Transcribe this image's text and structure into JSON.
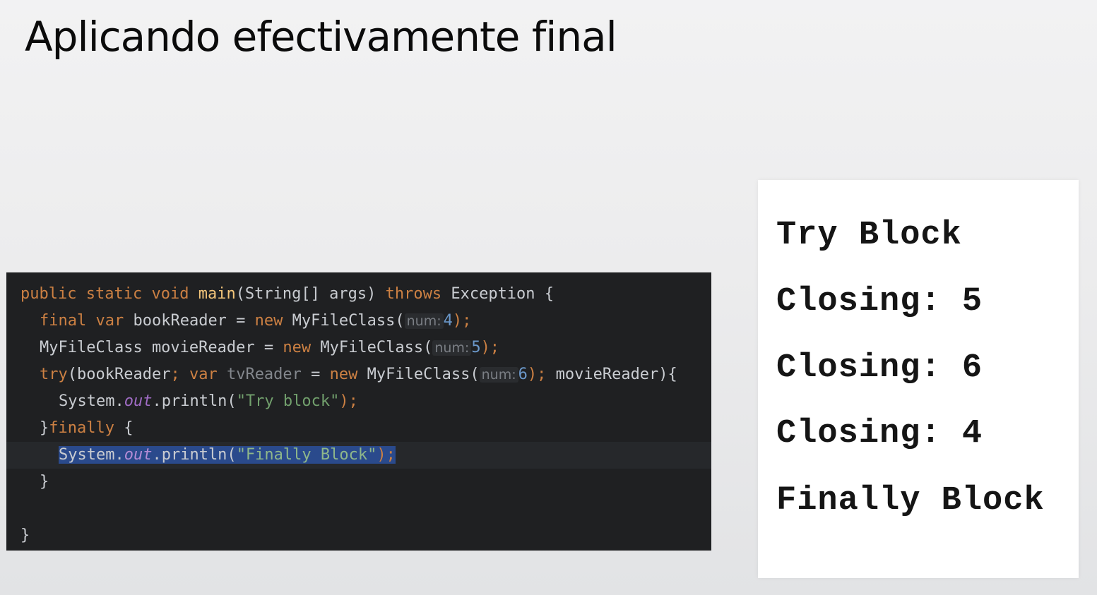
{
  "slide": {
    "title": "Aplicando efectivamente final"
  },
  "code": {
    "main_signature": {
      "kw_public": "public",
      "kw_static": "static",
      "kw_void": "void",
      "method": "main",
      "params": "(String[] args) ",
      "kw_throws": "throws",
      "tail": " Exception {"
    },
    "line2": {
      "kw_final": "final",
      "kw_var": "var",
      "text1": " bookReader = ",
      "kw_new": "new",
      "text2": " MyFileClass(",
      "hint": "num:",
      "num": "4",
      "end": ");"
    },
    "line3": {
      "text1": "MyFileClass movieReader = ",
      "kw_new": "new",
      "text2": " MyFileClass(",
      "hint": "num:",
      "num": "5",
      "end": ");"
    },
    "line4": {
      "kw_try": "try",
      "text1": "(bookReader",
      "semi1": ";",
      "kw_var": "var",
      "unused": "tvReader",
      "text2": " = ",
      "kw_new": "new",
      "text3": " MyFileClass(",
      "hint": "num:",
      "num": "6",
      "semi2": ");",
      "text4": " movieReader){"
    },
    "line5": {
      "sys": "System.",
      "out": "out",
      "call": ".println(",
      "str": "\"Try block\"",
      "end": ");"
    },
    "line6": {
      "brace": "}",
      "kw_finally": "finally",
      "tail": " {"
    },
    "line7": {
      "sys": "System.",
      "out": "out",
      "call": ".println(",
      "str": "\"Finally Block\"",
      "end": ");"
    },
    "line8": {
      "brace": "}"
    },
    "line10": {
      "brace": "}"
    }
  },
  "output": {
    "lines": [
      "Try Block",
      "Closing: 5",
      "Closing: 6",
      "Closing: 4",
      "Finally Block"
    ]
  }
}
